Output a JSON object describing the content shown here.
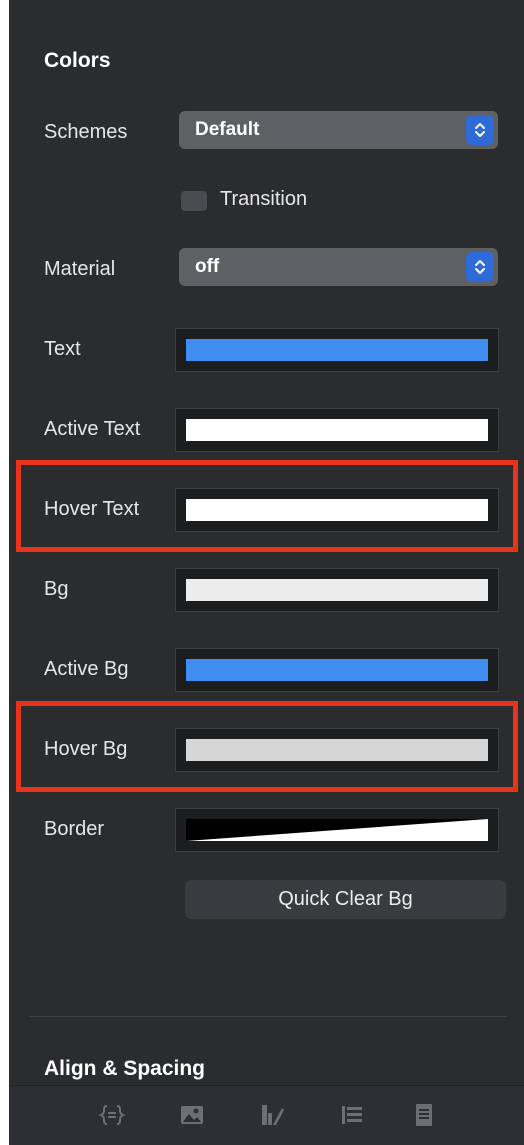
{
  "colors_section": {
    "title": "Colors",
    "schemes": {
      "label": "Schemes",
      "value": "Default"
    },
    "transition": {
      "label": "Transition"
    },
    "material": {
      "label": "Material",
      "value": "off"
    },
    "rows": [
      {
        "label": "Text",
        "swatch": "#3f8df0"
      },
      {
        "label": "Active Text",
        "swatch": "#ffffff"
      },
      {
        "label": "Hover Text",
        "swatch": "#ffffff"
      },
      {
        "label": "Bg",
        "swatch": "#ececec"
      },
      {
        "label": "Active Bg",
        "swatch": "#3f8df0"
      },
      {
        "label": "Hover Bg",
        "swatch": "#d6d6d6"
      },
      {
        "label": "Border",
        "swatch": "gradient-black-white"
      }
    ],
    "quick_clear_label": "Quick Clear Bg"
  },
  "align_section": {
    "title": "Align & Spacing"
  },
  "toolbar": {
    "icons": [
      "braces-icon",
      "image-icon",
      "styles-icon",
      "list-icon",
      "document-icon"
    ]
  },
  "theme": {
    "panel_bg": "#2b2c2e",
    "accent_blue": "#2f6bd8",
    "highlight_red": "#e8321b"
  }
}
